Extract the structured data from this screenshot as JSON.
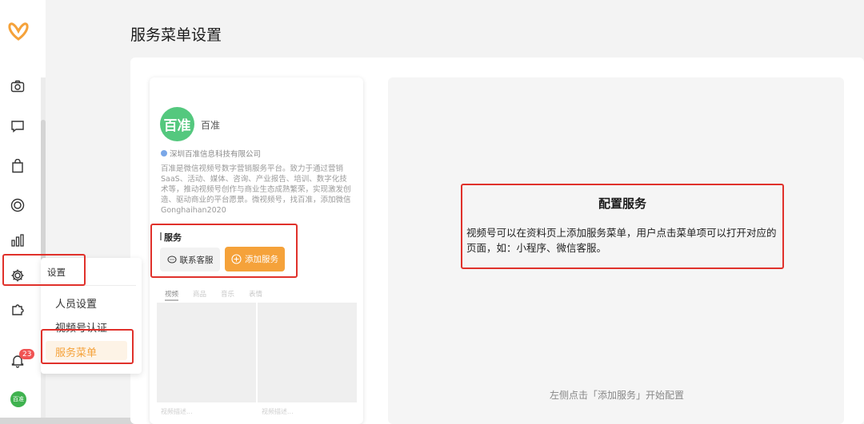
{
  "page": {
    "title": "服务菜单设置"
  },
  "nav": {
    "icons": [
      "camera-icon",
      "chat-icon",
      "bag-icon",
      "target-icon",
      "chart-icon",
      "gear-icon",
      "puzzle-icon",
      "bell-icon"
    ],
    "notification_count": "23",
    "avatar_text": "百准"
  },
  "settings_menu": {
    "header": "设置",
    "items": [
      {
        "label": "人员设置"
      },
      {
        "label": "视频号认证"
      },
      {
        "label": "服务菜单"
      }
    ],
    "active_index": 2
  },
  "preview": {
    "avatar_text": "百准",
    "account_name": "百准",
    "company": "深圳百准信息科技有限公司",
    "description": "百准是微信视频号数字营销服务平台。致力于通过营销SaaS、活动、媒体、咨询、产业报告、培训、数字化技术等，推动视频号创作与商业生态成熟繁荣，实现激发创造、驱动商业的平台愿景。微视频号，找百准，添加微信Gonghaihan2020",
    "service_title": "服务",
    "contact_button": "联系客服",
    "add_button": "添加服务",
    "tabs": [
      "视频",
      "商品",
      "音乐",
      "表情"
    ],
    "video_captions": [
      "视频描述...",
      "视频描述..."
    ]
  },
  "config": {
    "title": "配置服务",
    "body": "视频号可以在资料页上添加服务菜单，用户点击菜单项可以打开对应的页面，如：小程序、微信客服。",
    "hint": "左侧点击「添加服务」开始配置"
  },
  "colors": {
    "accent": "#f5a23a",
    "highlight": "#e0312b",
    "brand_green": "#54c87e",
    "badge": "#f05353"
  }
}
